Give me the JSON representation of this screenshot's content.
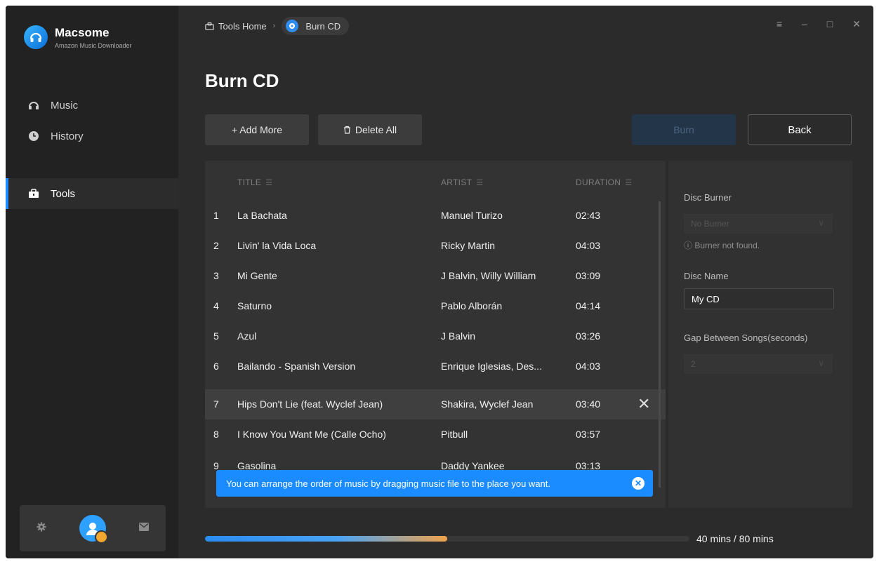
{
  "brand": {
    "name": "Macsome",
    "subtitle": "Amazon Music Downloader"
  },
  "nav": [
    {
      "label": "Music",
      "icon": "headphones-icon"
    },
    {
      "label": "History",
      "icon": "clock-icon"
    },
    {
      "label": "Tools",
      "icon": "toolbox-icon",
      "active": true
    }
  ],
  "bottom_bar": {
    "icons": [
      "gear-icon",
      "avatar",
      "mail-icon"
    ]
  },
  "breadcrumb": {
    "home": "Tools Home",
    "current": "Burn CD"
  },
  "window_controls": [
    "menu-icon",
    "minimize-icon",
    "maximize-icon",
    "close-icon"
  ],
  "page_title": "Burn CD",
  "toolbar": {
    "add_more": "+ Add More",
    "delete_all": "Delete All",
    "burn": "Burn",
    "back": "Back"
  },
  "table": {
    "headers": {
      "title": "TITLE",
      "artist": "ARTIST",
      "duration": "DURATION"
    },
    "rows": [
      {
        "num": "1",
        "title": "La Bachata",
        "artist": "Manuel Turizo",
        "duration": "02:43"
      },
      {
        "num": "2",
        "title": "Livin' la Vida Loca",
        "artist": "Ricky Martin",
        "duration": "04:03"
      },
      {
        "num": "3",
        "title": "Mi Gente",
        "artist": "J Balvin, Willy William",
        "duration": "03:09"
      },
      {
        "num": "4",
        "title": "Saturno",
        "artist": "Pablo Alborán",
        "duration": "04:14"
      },
      {
        "num": "5",
        "title": "Azul",
        "artist": "J Balvin",
        "duration": "03:26"
      },
      {
        "num": "6",
        "title": "Bailando - Spanish Version",
        "artist": "Enrique Iglesias, Des...",
        "duration": "04:03"
      },
      {
        "num": "7",
        "title": "Hips Don't Lie (feat. Wyclef Jean)",
        "artist": "Shakira, Wyclef Jean",
        "duration": "03:40",
        "selected": true
      },
      {
        "num": "8",
        "title": "I Know You Want Me (Calle Ocho)",
        "artist": "Pitbull",
        "duration": "03:57"
      },
      {
        "num": "9",
        "title": "Gasolina",
        "artist": "Daddy Yankee",
        "duration": "03:13"
      }
    ]
  },
  "tooltip": {
    "text": "You can arrange the order of music by dragging music file to the place you want."
  },
  "side_panel": {
    "disc_burner_label": "Disc Burner",
    "disc_burner_value": "No Burner",
    "burner_note": "Burner not found.",
    "disc_name_label": "Disc Name",
    "disc_name_value": "My CD",
    "gap_label": "Gap Between Songs(seconds)",
    "gap_value": "2"
  },
  "capacity": {
    "label": "40 mins / 80 mins",
    "fraction": 0.5
  },
  "colors": {
    "accent": "#1a8cff",
    "progress_end": "#f0a24a"
  }
}
